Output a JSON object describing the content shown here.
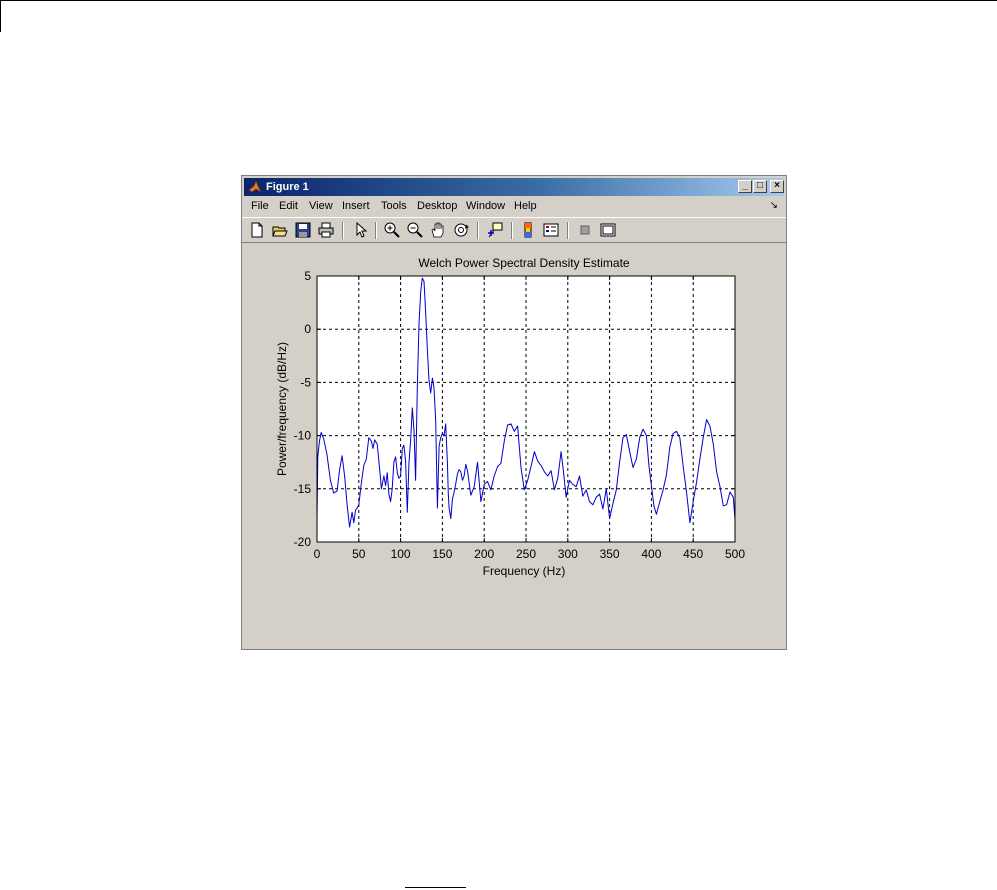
{
  "window": {
    "title": "Figure 1",
    "minimize_glyph": "_",
    "maximize_glyph": "□",
    "close_glyph": "×"
  },
  "menu": {
    "items": [
      "File",
      "Edit",
      "View",
      "Insert",
      "Tools",
      "Desktop",
      "Window",
      "Help"
    ],
    "dock_glyph": "↘"
  },
  "toolbar": {
    "icons": [
      "new-figure-icon",
      "open-file-icon",
      "save-icon",
      "print-icon",
      "edit-plot-arrow-icon",
      "zoom-in-icon",
      "zoom-out-icon",
      "pan-hand-icon",
      "rotate-3d-icon",
      "data-cursor-icon",
      "colorbar-icon",
      "legend-icon",
      "hide-plot-tools-icon",
      "show-plot-tools-icon"
    ]
  },
  "colors": {
    "line": "#0000cc",
    "figure_bg": "#d4d0c8",
    "axes_bg": "#ffffff",
    "title_bar_start": "#0a246a",
    "title_bar_end": "#a6caf0"
  },
  "chart_data": {
    "type": "line",
    "title": "Welch Power Spectral Density Estimate",
    "xlabel": "Frequency (Hz)",
    "ylabel": "Power/frequency (dB/Hz)",
    "xlim": [
      0,
      500
    ],
    "ylim": [
      -20,
      5
    ],
    "xticks": [
      0,
      50,
      100,
      150,
      200,
      250,
      300,
      350,
      400,
      450,
      500
    ],
    "yticks": [
      5,
      0,
      -5,
      -10,
      -15,
      -20
    ],
    "grid": true,
    "grid_style": "dotted",
    "series": [
      {
        "x": [
          0,
          1,
          3,
          5,
          8,
          12,
          16,
          20,
          24,
          27,
          30,
          33,
          36,
          39,
          42,
          44,
          46,
          48,
          50,
          53,
          56,
          59,
          62,
          65,
          67,
          69,
          72,
          75,
          77,
          80,
          82,
          84,
          86,
          88,
          90,
          92,
          94,
          96,
          98,
          100,
          102,
          104,
          106,
          108,
          110,
          112,
          114,
          116,
          118,
          120,
          122,
          124,
          126,
          128,
          130,
          132,
          134,
          136,
          138,
          140,
          142,
          144,
          146,
          148,
          150,
          152,
          154,
          156,
          157,
          158,
          160,
          162,
          164,
          166,
          168,
          170,
          172,
          174,
          176,
          178,
          180,
          184,
          188,
          192,
          196,
          200,
          204,
          208,
          212,
          216,
          220,
          224,
          228,
          232,
          236,
          240,
          244,
          248,
          252,
          256,
          260,
          264,
          268,
          272,
          276,
          280,
          284,
          288,
          292,
          295,
          298,
          302,
          306,
          310,
          314,
          318,
          322,
          326,
          330,
          334,
          338,
          342,
          346,
          350,
          354,
          358,
          362,
          366,
          370,
          374,
          378,
          382,
          386,
          390,
          394,
          397,
          400,
          403,
          406,
          410,
          414,
          418,
          422,
          426,
          430,
          434,
          438,
          442,
          446,
          450,
          454,
          458,
          462,
          466,
          470,
          474,
          478,
          482,
          486,
          490,
          494,
          498,
          500
        ],
        "y": [
          -18,
          -12,
          -10.5,
          -9.7,
          -10.3,
          -11.8,
          -14.2,
          -15.4,
          -15.2,
          -13.2,
          -11.9,
          -13.8,
          -16.5,
          -18.6,
          -17.2,
          -18.2,
          -17,
          -16.8,
          -16.5,
          -14.5,
          -12.8,
          -12.2,
          -10.2,
          -10.5,
          -11.2,
          -10.4,
          -10.8,
          -13.2,
          -15,
          -13.8,
          -14.7,
          -13.5,
          -15.5,
          -16.2,
          -15,
          -12.5,
          -12,
          -13.5,
          -14,
          -13.8,
          -11.2,
          -10.9,
          -12.4,
          -17.2,
          -12.5,
          -10.5,
          -7.4,
          -9.5,
          -14.2,
          -5.5,
          0.5,
          3.5,
          4.8,
          4.5,
          1.5,
          -2,
          -4.8,
          -6,
          -4.6,
          -5.5,
          -8.6,
          -16.8,
          -11,
          -10.2,
          -9.8,
          -10,
          -8.9,
          -12.5,
          -15.5,
          -16.8,
          -17.8,
          -16,
          -15.3,
          -14.5,
          -13.6,
          -13.2,
          -13.4,
          -14.2,
          -13.8,
          -12.7,
          -13.3,
          -15.6,
          -14.8,
          -12.5,
          -16.2,
          -14.6,
          -14.3,
          -15.1,
          -13.8,
          -12.9,
          -12.6,
          -10.5,
          -9,
          -8.9,
          -9.6,
          -9.1,
          -13,
          -15.1,
          -14.2,
          -12.9,
          -11.5,
          -12.4,
          -12.8,
          -13.4,
          -13.8,
          -13.3,
          -15.1,
          -14,
          -11.5,
          -13.5,
          -15.8,
          -14.2,
          -14.6,
          -14.8,
          -13.8,
          -15.7,
          -15.1,
          -16.2,
          -16.5,
          -15.8,
          -15.5,
          -16.9,
          -15,
          -17.8,
          -16.4,
          -15.1,
          -12.5,
          -10.2,
          -9.9,
          -11.5,
          -13,
          -12.2,
          -10.2,
          -9.4,
          -10,
          -12.8,
          -14.7,
          -16.6,
          -17.4,
          -16.2,
          -15.1,
          -13.7,
          -11.1,
          -9.8,
          -9.6,
          -10.2,
          -12.9,
          -15.3,
          -18.2,
          -16.2,
          -14.4,
          -12.2,
          -10.2,
          -8.5,
          -9.1,
          -10.8,
          -13.4,
          -14.8,
          -16.6,
          -16.5,
          -15.3,
          -15.8,
          -17.9
        ]
      }
    ]
  }
}
